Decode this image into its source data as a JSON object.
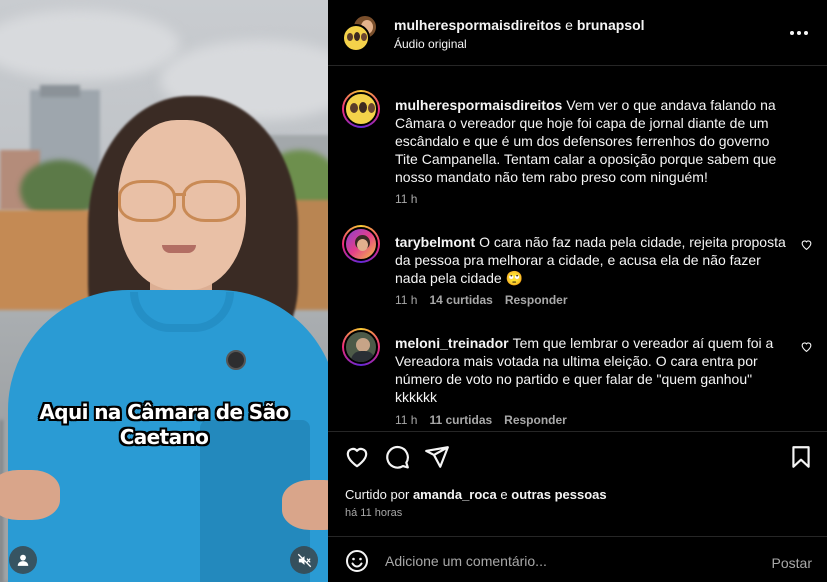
{
  "video": {
    "caption_line1": "Aqui na Câmara de São",
    "caption_line2": "Caetano"
  },
  "header": {
    "user1": "mulherespormaisdireitos",
    "separator": "e",
    "user2": "brunapsol",
    "audio": "Áudio original",
    "more_icon": "more-horizontal-icon"
  },
  "caption_comment": {
    "user": "mulherespormaisdireitos",
    "text": "Vem ver o que andava falando na Câmara o vereador que hoje foi capa de jornal diante de um escândalo e que é um dos defensores ferrenhos do governo Tite Campanella. Tentam calar a oposição porque sabem que nosso mandato não tem rabo preso com ninguém!",
    "time": "11 h"
  },
  "comments": [
    {
      "user": "tarybelmont",
      "text": "O cara não faz nada pela cidade, rejeita proposta da pessoa pra melhorar a cidade, e acusa ela de não fazer nada pela cidade 🙄",
      "time": "11 h",
      "likes": "14 curtidas",
      "reply": "Responder"
    },
    {
      "user": "meloni_treinador",
      "text": "Tem que lembrar o vereador aí quem foi a Vereadora mais votada na ultima eleição. O cara entra por número de voto no partido e quer falar de \"quem ganhou\" kkkkkk",
      "time": "11 h",
      "likes": "11 curtidas",
      "reply": "Responder"
    }
  ],
  "liked_by": {
    "prefix": "Curtido por",
    "user": "amanda_roca",
    "conj": "e",
    "others": "outras pessoas"
  },
  "timestamp": "há 11 horas",
  "add_comment": {
    "placeholder": "Adicione um comentário...",
    "post": "Postar"
  },
  "colors": {
    "background": "#000000",
    "text": "#f5f5f5",
    "muted": "#a8a8a8",
    "shirt": "#2a9bd4"
  }
}
